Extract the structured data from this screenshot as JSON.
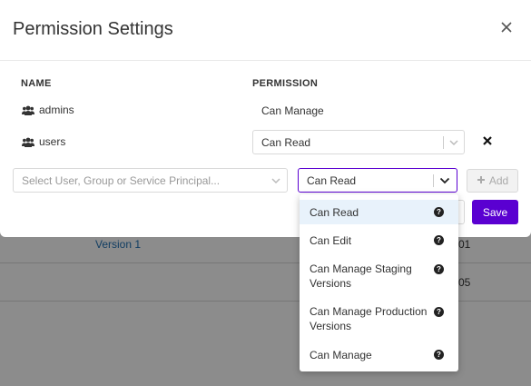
{
  "background": {
    "rows": [
      {
        "link": "Version 1",
        "tail": "01"
      },
      {
        "link": "",
        "tail": "05"
      }
    ]
  },
  "modal": {
    "title": "Permission Settings",
    "close_icon": "close-icon",
    "columns": {
      "name": "NAME",
      "permission": "PERMISSION"
    },
    "principals": [
      {
        "name": "admins",
        "icon": "users-icon",
        "permission": "Can Manage"
      },
      {
        "name": "users",
        "icon": "users-icon",
        "permission": "Can Read"
      }
    ],
    "remove_label": "×",
    "new_entry": {
      "principal_placeholder": "Select User, Group or Service Principal...",
      "permission_value": "Can Read",
      "add_label": "Add"
    },
    "save_label": "Save",
    "accent": "#5a00d1"
  },
  "dropdown": {
    "options": [
      {
        "label": "Can Read",
        "active": true
      },
      {
        "label": "Can Edit",
        "active": false
      },
      {
        "label": "Can Manage Staging Versions",
        "active": false
      },
      {
        "label": "Can Manage Production Versions",
        "active": false
      },
      {
        "label": "Can Manage",
        "active": false
      }
    ],
    "help_glyph": "?"
  }
}
